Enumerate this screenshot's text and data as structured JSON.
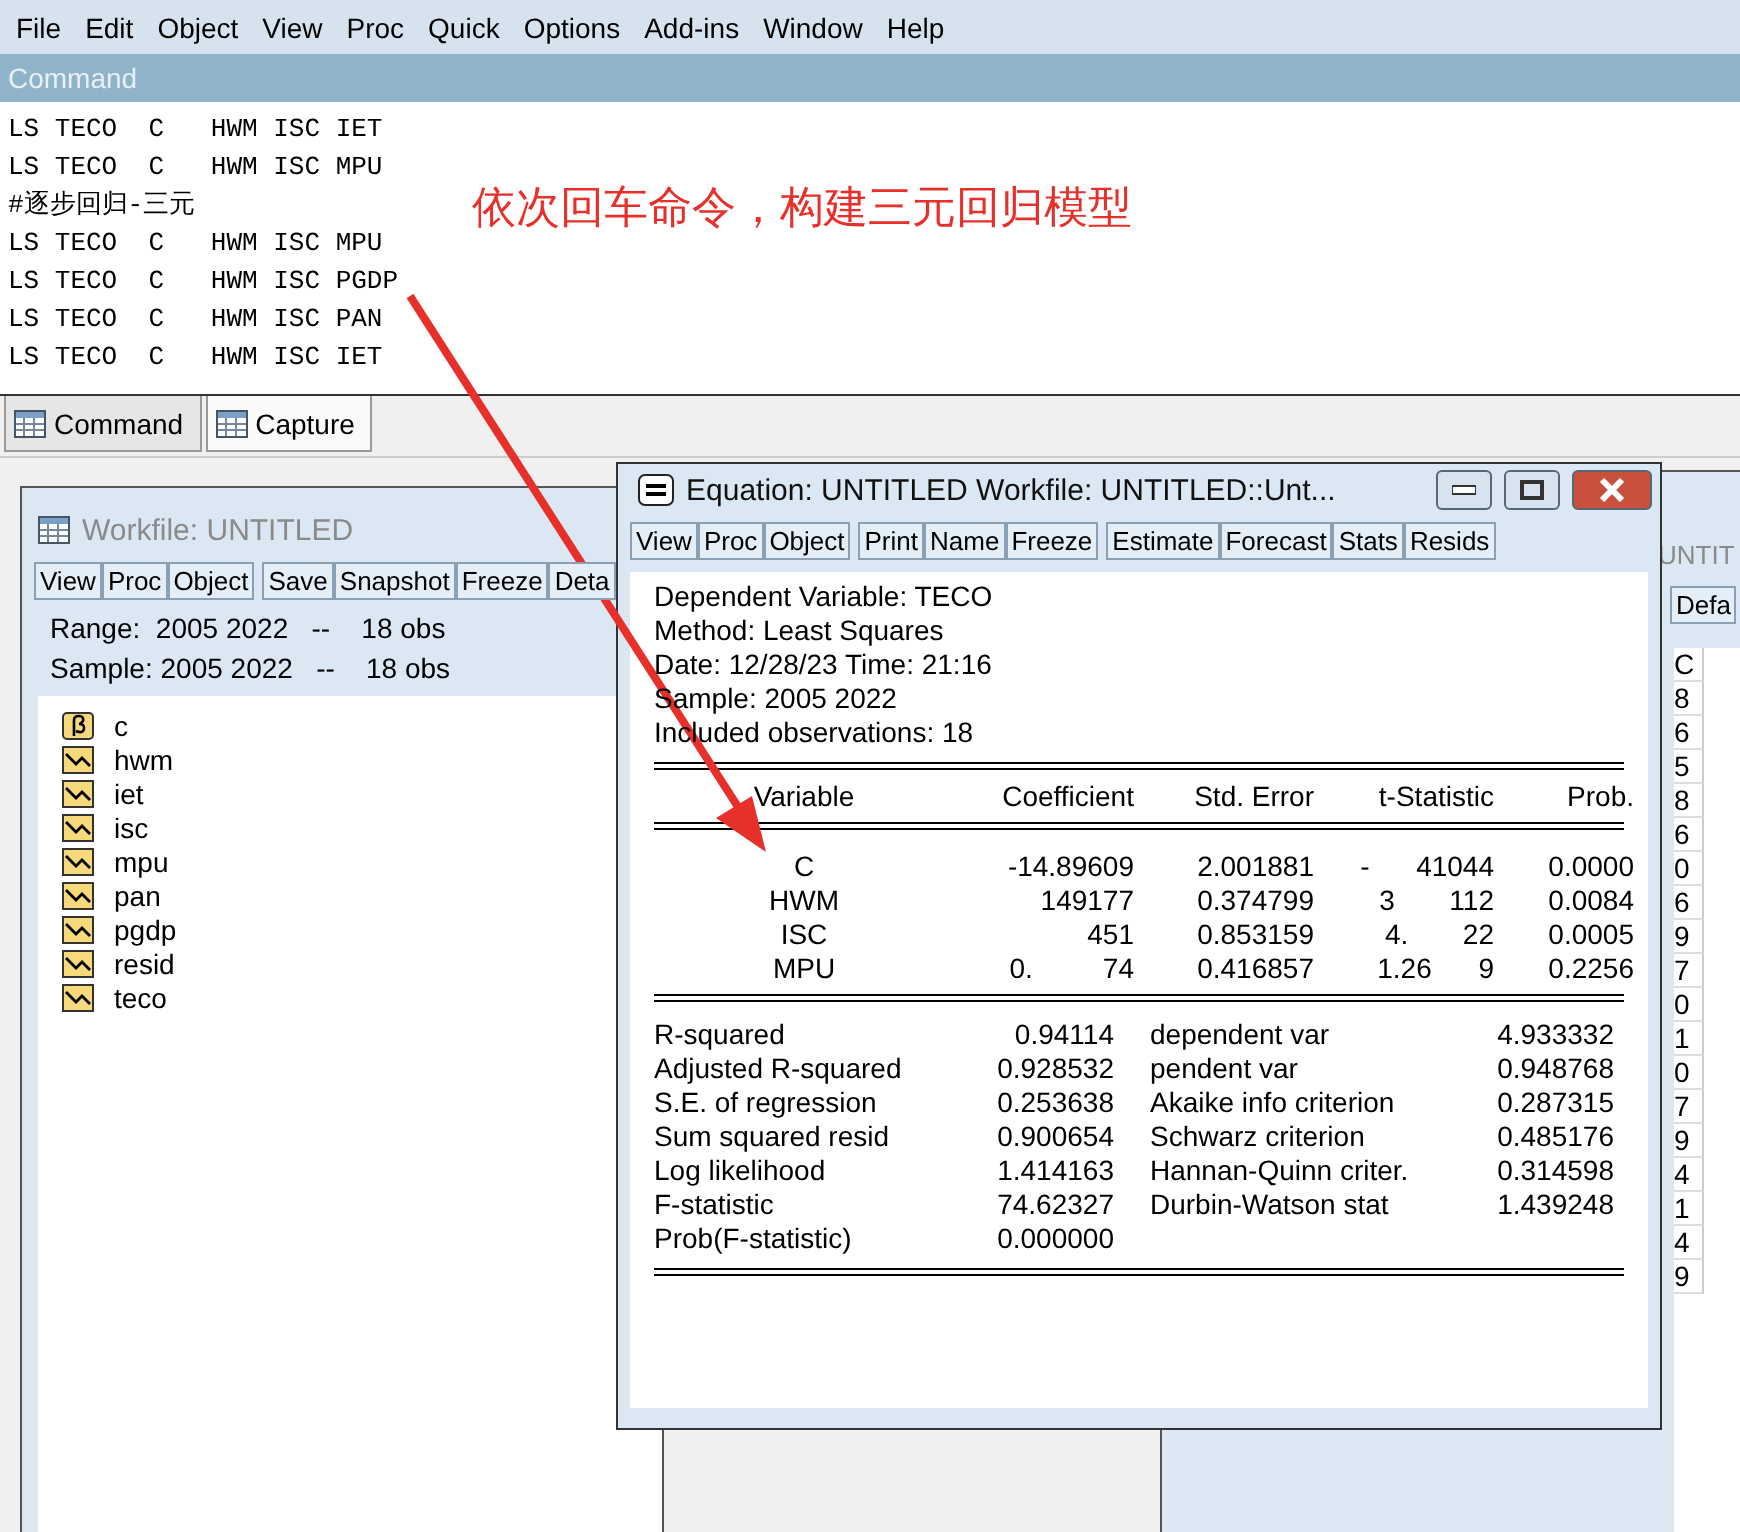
{
  "menu": [
    "File",
    "Edit",
    "Object",
    "View",
    "Proc",
    "Quick",
    "Options",
    "Add-ins",
    "Window",
    "Help"
  ],
  "command": {
    "title": "Command",
    "lines": [
      "LS TECO  C   HWM ISC IET",
      "LS TECO  C   HWM ISC MPU",
      "#逐步回归-三元",
      "LS TECO  C   HWM ISC MPU",
      "LS TECO  C   HWM ISC PGDP",
      "LS TECO  C   HWM ISC PAN",
      "LS TECO  C   HWM ISC IET"
    ],
    "annotation": "依次回车命令，构建三元回归模型"
  },
  "tabs": [
    {
      "label": "Command",
      "selected": true
    },
    {
      "label": "Capture",
      "selected": false
    }
  ],
  "workfile": {
    "title": "Workfile: UNTITLED",
    "toolbar": [
      [
        "View",
        "Proc",
        "Object"
      ],
      [
        "Save",
        "Snapshot",
        "Freeze",
        "Deta"
      ]
    ],
    "range": "Range:  2005 2022   --    18 obs",
    "sample": "Sample: 2005 2022   --    18 obs",
    "objects": [
      {
        "name": "c",
        "kind": "coef"
      },
      {
        "name": "hwm",
        "kind": "series"
      },
      {
        "name": "iet",
        "kind": "series"
      },
      {
        "name": "isc",
        "kind": "series"
      },
      {
        "name": "mpu",
        "kind": "series"
      },
      {
        "name": "pan",
        "kind": "series"
      },
      {
        "name": "pgdp",
        "kind": "series"
      },
      {
        "name": "resid",
        "kind": "series"
      },
      {
        "name": "teco",
        "kind": "series"
      }
    ]
  },
  "background_window": {
    "title": "UNTIT",
    "field": "Defa",
    "column": "C",
    "values": [
      "8",
      "6",
      "5",
      "8",
      "6",
      "0",
      "6",
      "9",
      "7",
      "0",
      "1",
      "0",
      "7",
      "9",
      "4",
      "1",
      "4",
      "9"
    ]
  },
  "equation": {
    "title": "Equation: UNTITLED   Workfile: UNTITLED::Unt...",
    "toolbar": [
      [
        "View",
        "Proc",
        "Object"
      ],
      [
        "Print",
        "Name",
        "Freeze"
      ],
      [
        "Estimate",
        "Forecast",
        "Stats",
        "Resids"
      ]
    ],
    "header": [
      "Dependent Variable: TECO",
      "Method: Least Squares",
      "Date: 12/28/23   Time: 21:16",
      "Sample: 2005 2022",
      "Included observations: 18"
    ],
    "columns": [
      "Variable",
      "Coefficient",
      "Std. Error",
      "t-Statistic",
      "Prob."
    ],
    "rows": [
      [
        "C",
        "-14.89609",
        "2.001881",
        "-      41044",
        "0.0000"
      ],
      [
        "HWM",
        "149177",
        "0.374799",
        "3       112",
        "0.0084"
      ],
      [
        "ISC",
        "451",
        "0.853159",
        "4.       22",
        "0.0005"
      ],
      [
        "MPU",
        "0.         74",
        "0.416857",
        "1.26      9",
        "0.2256"
      ]
    ],
    "stats": [
      [
        "R-squared",
        "0.94114",
        "dependent var",
        "4.933332"
      ],
      [
        "Adjusted R-squared",
        "0.928532",
        "pendent var",
        "0.948768"
      ],
      [
        "S.E. of regression",
        "0.253638",
        "Akaike info criterion",
        "0.287315"
      ],
      [
        "Sum squared resid",
        "0.900654",
        "Schwarz criterion",
        "0.485176"
      ],
      [
        "Log likelihood",
        "1.414163",
        "Hannan-Quinn criter.",
        "0.314598"
      ],
      [
        "F-statistic",
        "74.62327",
        "Durbin-Watson stat",
        "1.439248"
      ],
      [
        "Prob(F-statistic)",
        "0.000000"
      ]
    ]
  }
}
